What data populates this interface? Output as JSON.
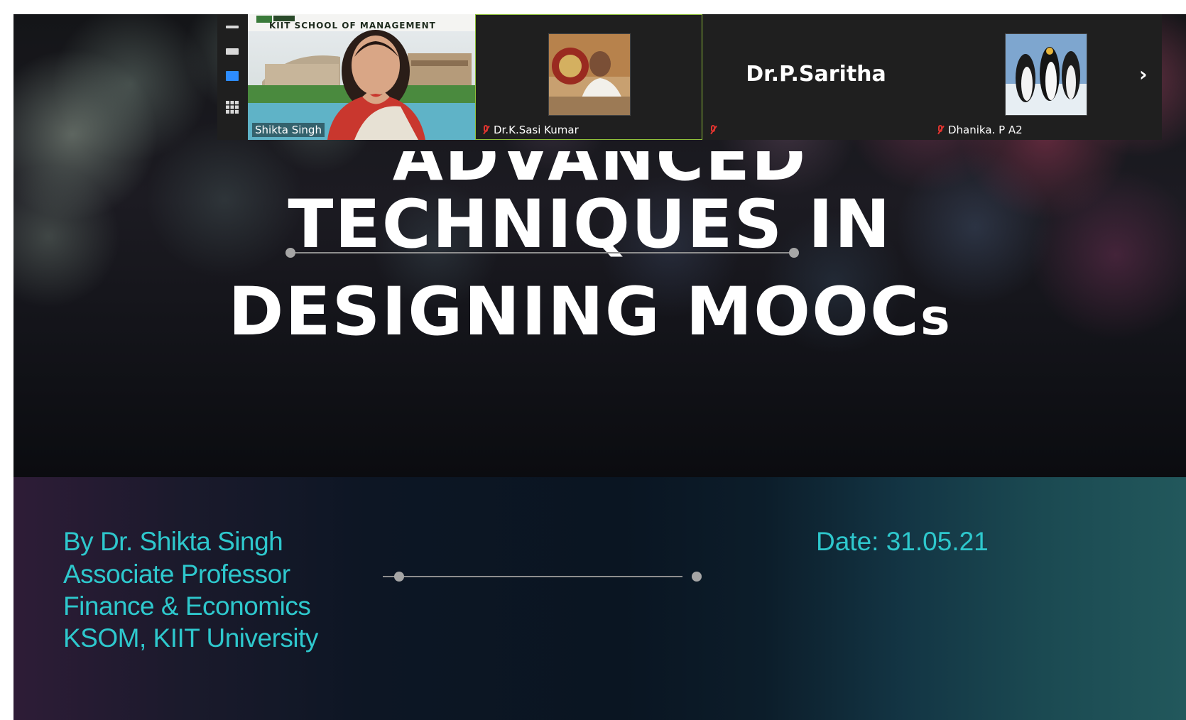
{
  "slide": {
    "title_partial": "ADVANCED",
    "title_line1": "TECHNIQUES IN",
    "title_line2_main": "DESIGNING MOOC",
    "title_line2_suffix": "s",
    "author_lines": [
      "By Dr. Shikta Singh",
      "Associate Professor",
      "Finance & Economics",
      "KSOM, KIIT University"
    ],
    "date": "Date: 31.05.21"
  },
  "meeting": {
    "participants": [
      {
        "name": "Shikta Singh",
        "muted": false,
        "background_text": "KIIT SCHOOL OF MANAGEMENT"
      },
      {
        "name": "Dr.K.Sasi Kumar",
        "muted": true
      },
      {
        "name": "Dr.P.Saritha",
        "muted": true,
        "display_name_large": "Dr.P.Saritha"
      },
      {
        "name": "Dhanika. P A2",
        "muted": true
      }
    ],
    "view_controls": [
      "minimize-view",
      "speaker-view",
      "strip-view",
      "gallery-view"
    ],
    "next_page_glyph": "›"
  },
  "colors": {
    "accent_text": "#2ec8cd",
    "strip_background": "#1b1b1b",
    "mute_red": "#e0342f",
    "active_speaker_border": "#8fbf3a"
  }
}
